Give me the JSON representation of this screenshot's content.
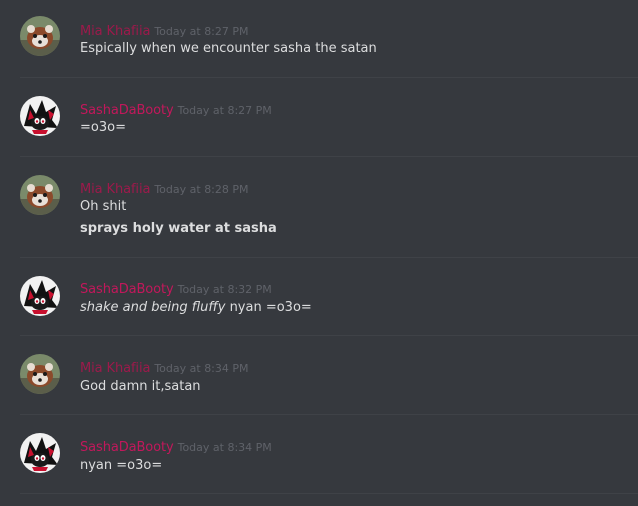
{
  "messages": [
    {
      "author": "Mia Khafiia",
      "timestamp": "Today at 8:27 PM",
      "avatar": "red-panda-avatar",
      "lines": [
        "Espically when we encounter sasha the satan"
      ]
    },
    {
      "author": "SashaDaBooty",
      "timestamp": "Today at 8:27 PM",
      "avatar": "dark-hedgehog-avatar",
      "lines": [
        "=o3o="
      ]
    },
    {
      "author": "Mia Khafiia",
      "timestamp": "Today at 8:28 PM",
      "avatar": "red-panda-avatar",
      "lines": [
        "Oh shit",
        "sprays holy water at sasha"
      ]
    },
    {
      "author": "SashaDaBooty",
      "timestamp": "Today at 8:32 PM",
      "avatar": "dark-hedgehog-avatar",
      "lines": [],
      "italic_part": "shake and being fluffy",
      "plain_part": " nyan =o3o="
    },
    {
      "author": "Mia Khafiia",
      "timestamp": "Today at 8:34 PM",
      "avatar": "red-panda-avatar",
      "lines": [
        "God damn it,satan"
      ]
    },
    {
      "author": "SashaDaBooty",
      "timestamp": "Today at 8:34 PM",
      "avatar": "dark-hedgehog-avatar",
      "lines": [
        "nyan =o3o="
      ]
    }
  ],
  "colors": {
    "background": "#36393e",
    "divider": "#3f4247",
    "username_sasha": "#c2185b",
    "username_mia": "#9c1a4b",
    "timestamp": "#5f6269",
    "text": "#dcddde"
  }
}
